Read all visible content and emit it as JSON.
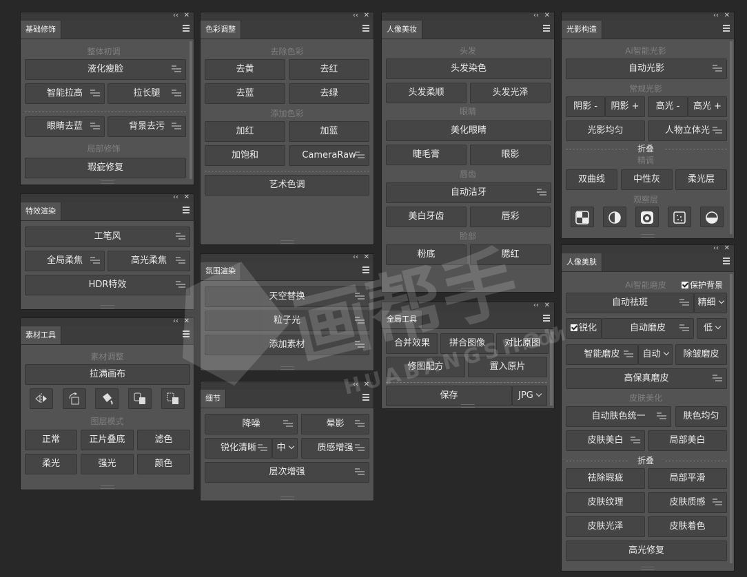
{
  "p1": {
    "tab": "基础修饰",
    "s1": "整体初调",
    "b1": "液化瘦脸",
    "b2": "智能拉高",
    "b3": "拉长腿",
    "b4": "眼睛去蓝",
    "b5": "背景去污",
    "s2": "局部修饰",
    "b6": "瑕疵修复"
  },
  "p2": {
    "tab": "特效渲染",
    "b1": "工笔风",
    "b2": "全局柔焦",
    "b3": "高光柔焦",
    "b4": "HDR特效"
  },
  "p3": {
    "tab": "素材工具",
    "s1": "素材调整",
    "b1": "拉满画布",
    "s2": "图层模式",
    "b2": "正常",
    "b3": "正片叠底",
    "b4": "滤色",
    "b5": "柔光",
    "b6": "强光",
    "b7": "颜色",
    "icons": [
      "flip-horizontal-icon",
      "rotate-icon",
      "fill-bucket-icon",
      "layer-copy-icon",
      "layer-swap-icon"
    ]
  },
  "p4": {
    "tab": "色彩调整",
    "s1": "去除色彩",
    "b1": "去黄",
    "b2": "去红",
    "b3": "去蓝",
    "b4": "去绿",
    "s2": "添加色彩",
    "b5": "加红",
    "b6": "加蓝",
    "b7": "加饱和",
    "b8": "CameraRaw",
    "b9": "艺术色调"
  },
  "p5": {
    "tab": "氛围渲染",
    "b1": "天空替换",
    "b2": "粒子光",
    "b3": "添加素材"
  },
  "p6": {
    "tab": "细节",
    "b1": "降噪",
    "b2": "晕影",
    "b3": "锐化清晰",
    "b3v": "中",
    "b4": "质感增强",
    "b5": "层次增强"
  },
  "p7": {
    "tab": "人像美妆",
    "s1": "头发",
    "b1": "头发染色",
    "b2": "头发柔顺",
    "b3": "头发光泽",
    "s2": "眼睛",
    "b4": "美化眼睛",
    "b5": "睫毛膏",
    "b6": "眼影",
    "s3": "唇齿",
    "b7": "自动洁牙",
    "b8": "美白牙齿",
    "b9": "唇彩",
    "s4": "脸部",
    "b10": "粉底",
    "b11": "腮红"
  },
  "p8": {
    "tab": "全局工具",
    "b1": "合并效果",
    "b2": "拼合图像",
    "b3": "对比原图",
    "b4": "修图配方",
    "b5": "置入原片",
    "b6": "保存",
    "b6v": "JPG"
  },
  "p9": {
    "tab": "光影构造",
    "s1": "Ai智能光影",
    "b1": "自动光影",
    "s2": "常规光影",
    "b2": "阴影 -",
    "b3": "阴影 +",
    "b4": "高光 -",
    "b5": "高光 +",
    "b6": "光影均匀",
    "b7": "人物立体光",
    "f1": "折叠",
    "s3": "精调",
    "b8": "双曲线",
    "b9": "中性灰",
    "b10": "柔光层",
    "s4": "观察层",
    "icons": [
      "checker-icon",
      "contrast-icon",
      "face-mask-icon",
      "noise-icon",
      "half-circle-icon"
    ]
  },
  "p10": {
    "tab": "人像美肤",
    "s1": "Ai智能磨皮",
    "protect": "保护背景",
    "b1": "自动祛斑",
    "b1v": "精细",
    "sharp": "锐化",
    "b2": "自动磨皮",
    "b2v": "低",
    "b3": "智能磨皮",
    "b3v": "自动",
    "b4": "除皱磨皮",
    "b5": "高保真磨皮",
    "s2": "皮肤美化",
    "b6": "自动肤色统一",
    "b7": "肤色均匀",
    "b8": "皮肤美白",
    "b9": "局部美白",
    "f1": "折叠",
    "b10": "祛除瑕疵",
    "b11": "局部平滑",
    "b12": "皮肤纹理",
    "b13": "皮肤质感",
    "b14": "皮肤光泽",
    "b15": "皮肤着色",
    "b16": "高光修复"
  },
  "watermark": {
    "brand": "HUABANGSHOU",
    "domain": ".COM",
    "logo": "画帮手"
  },
  "ui": {
    "collapse": "‹‹",
    "close": "✕"
  }
}
